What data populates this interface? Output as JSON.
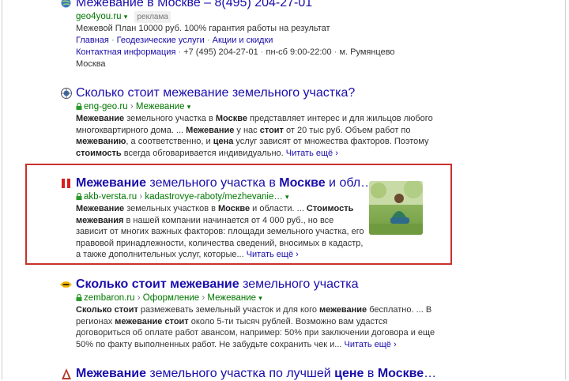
{
  "results": [
    {
      "title": "Межевание в Москве – 8(495) 204-27-01",
      "host": "geo4you.ru",
      "ad_label": "реклама",
      "snippet": "Межевой План 10000 руб. 100% гарантия работы на результат",
      "sitelinks": [
        "Главная",
        "Геодезические услуги",
        "Акции и скидки"
      ],
      "contacts": {
        "link": "Контактная информация",
        "phone": "+7 (495) 204-27-01",
        "hours": "пн-сб 9:00-22:00",
        "metro": "м. Румянцево",
        "city": "Москва"
      }
    },
    {
      "title_parts": [
        "Сколько стоит межевание",
        " земельного участка?"
      ],
      "host": "eng-geo.ru",
      "crumb": "Межевание",
      "snippet_html": "<b>Межевание</b> земельного участка в <b>Москве</b> представляет интерес и для жильцов любого многоквартирного дома. ... <b>Межевание</b> у нас <b>стоит</b> от 20 тыс руб. Объем работ по <b>межеванию</b>, а соответственно, и <b>цена</b> услуг зависят от множества факторов. Поэтому <b>стоимость</b> всегда обговаривается индивидуально.",
      "more": "Читать ещё"
    },
    {
      "title_html": "<b>Межевание</b> земельного участка в <b>Москве</b> и обл…",
      "host": "akb-versta.ru",
      "crumb": "kadastrovye-raboty/mezhevanie…",
      "snippet_html": "<b>Межевание</b> земельных участков в <b>Москве</b> и области. ... <b>Стоимость межевания</b> в нашей компании начинается от 4 000 руб., но все зависит от многих важных факторов: площади земельного участка, его правовой принадлежности, количества сведений, вносимых в кадастр, а также дополнительных услуг, которые...",
      "more": "Читать ещё"
    },
    {
      "title_html": "<b>Сколько стоит межевание</b> земельного участка",
      "host": "zembaron.ru",
      "crumbs": [
        "Оформление",
        "Межевание"
      ],
      "snippet_html": "<b>Сколько стоит</b> размежевать земельный участок и для кого <b>межевание</b> бесплатно. ... В регионах <b>межевание стоит</b> около 5-ти тысяч рублей. Возможно вам удастся договориться об оплате работ авансом, например: 50% при заключении договора и еще 50% по факту выполненных работ. Не забудьте сохранить чек и...",
      "more": "Читать ещё"
    },
    {
      "title_html": "<b>Межевание</b> земельного участка по лучшей <b>цене</b> в <b>Москве</b>…"
    }
  ]
}
